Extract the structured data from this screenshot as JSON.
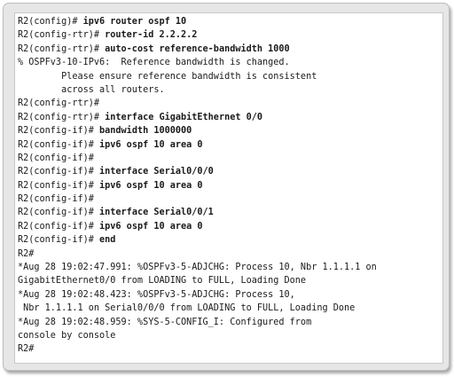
{
  "terminal": {
    "lines": [
      {
        "prompt": "R2(config)# ",
        "cmd": "ipv6 router ospf 10"
      },
      {
        "prompt": "R2(config-rtr)# ",
        "cmd": "router-id 2.2.2.2"
      },
      {
        "prompt": "R2(config-rtr)# ",
        "cmd": "auto-cost reference-bandwidth 1000"
      },
      {
        "prompt": "% OSPFv3-10-IPv6:  Reference bandwidth is changed.",
        "cmd": ""
      },
      {
        "prompt": "        Please ensure reference bandwidth is consistent",
        "cmd": ""
      },
      {
        "prompt": "        across all routers.",
        "cmd": ""
      },
      {
        "prompt": "R2(config-rtr)#",
        "cmd": ""
      },
      {
        "prompt": "R2(config-rtr)# ",
        "cmd": "interface GigabitEthernet 0/0"
      },
      {
        "prompt": "R2(config-if)# ",
        "cmd": "bandwidth 1000000"
      },
      {
        "prompt": "R2(config-if)# ",
        "cmd": "ipv6 ospf 10 area 0"
      },
      {
        "prompt": "R2(config-if)#",
        "cmd": ""
      },
      {
        "prompt": "R2(config-if)# ",
        "cmd": "interface Serial0/0/0"
      },
      {
        "prompt": "R2(config-if)# ",
        "cmd": "ipv6 ospf 10 area 0"
      },
      {
        "prompt": "R2(config-if)#",
        "cmd": ""
      },
      {
        "prompt": "R2(config-if)# ",
        "cmd": "interface Serial0/0/1"
      },
      {
        "prompt": "R2(config-if)# ",
        "cmd": "ipv6 ospf 10 area 0"
      },
      {
        "prompt": "R2(config-if)# ",
        "cmd": "end"
      },
      {
        "prompt": "R2#",
        "cmd": ""
      },
      {
        "prompt": "*Aug 28 19:02:47.991: %OSPFv3-5-ADJCHG: Process 10, Nbr 1.1.1.1 on",
        "cmd": ""
      },
      {
        "prompt": "GigabitEthernet0/0 from LOADING to FULL, Loading Done",
        "cmd": ""
      },
      {
        "prompt": "*Aug 28 19:02:48.423: %OSPFv3-5-ADJCHG: Process 10,",
        "cmd": ""
      },
      {
        "prompt": " Nbr 1.1.1.1 on Serial0/0/0 from LOADING to FULL, Loading Done",
        "cmd": ""
      },
      {
        "prompt": "*Aug 28 19:02:48.959: %SYS-5-CONFIG_I: Configured from",
        "cmd": ""
      },
      {
        "prompt": "console by console",
        "cmd": ""
      },
      {
        "prompt": "R2#",
        "cmd": ""
      }
    ]
  }
}
